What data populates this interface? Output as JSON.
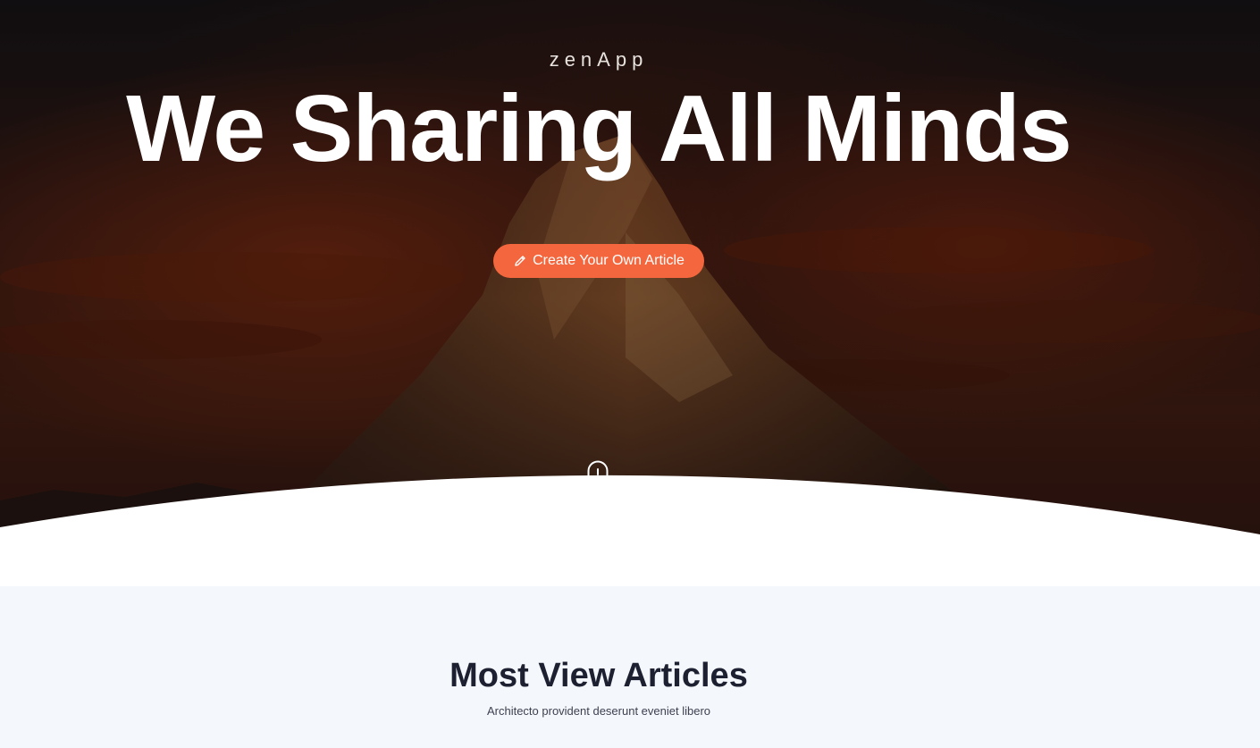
{
  "hero": {
    "brand": "zenApp",
    "title": "We Sharing All Minds",
    "cta_label": "Create Your Own Article",
    "cta_icon": "pencil-icon",
    "scroll_icon": "mouse-scroll-icon"
  },
  "articles": {
    "title": "Most View Articles",
    "subtitle": "Architecto provident deserunt eveniet libero"
  },
  "colors": {
    "accent": "#f4673e",
    "section_bg": "#f4f7fb",
    "heading": "#1d2030"
  }
}
